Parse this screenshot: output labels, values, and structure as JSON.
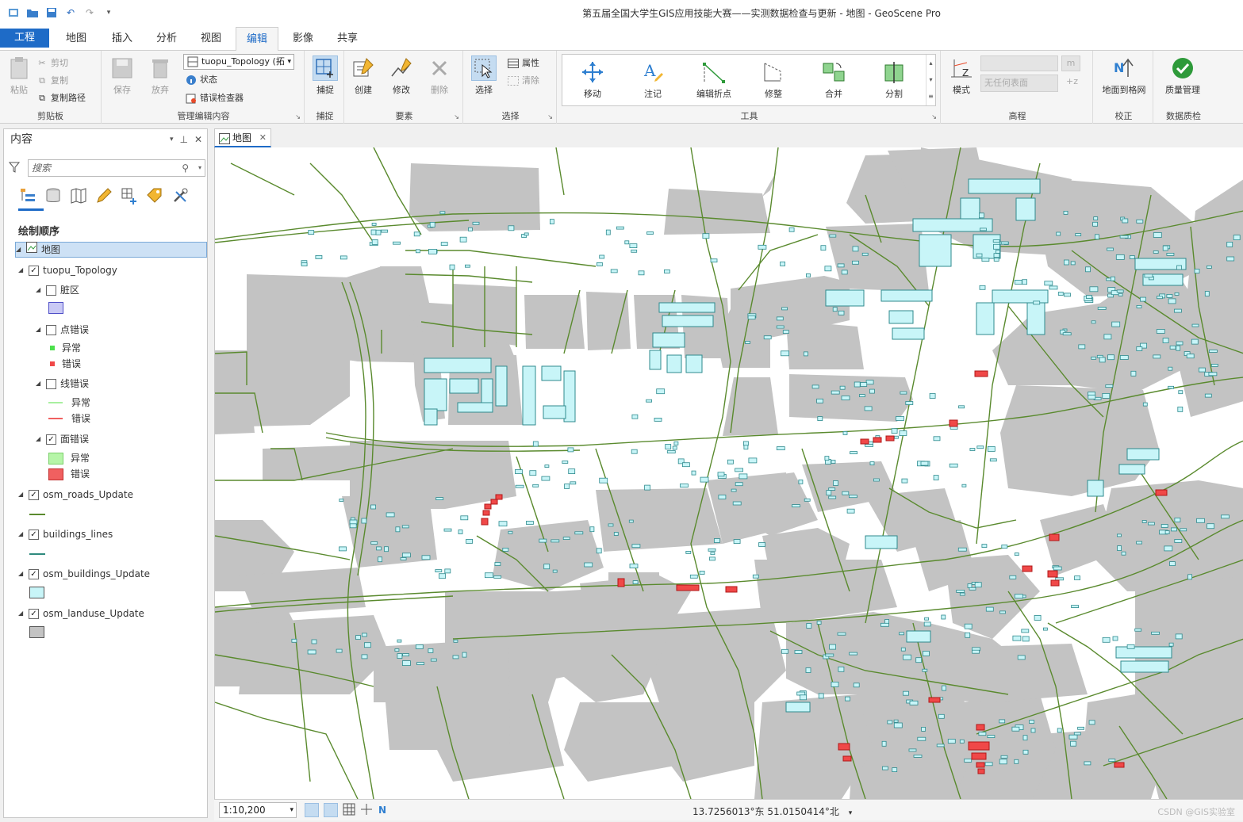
{
  "window": {
    "title": "第五届全国大学生GIS应用技能大赛——实测数据检查与更新 - 地图 - GeoScene Pro"
  },
  "tabs": [
    {
      "label": "工程"
    },
    {
      "label": "地图"
    },
    {
      "label": "插入"
    },
    {
      "label": "分析"
    },
    {
      "label": "视图"
    },
    {
      "label": "编辑"
    },
    {
      "label": "影像"
    },
    {
      "label": "共享"
    }
  ],
  "ribbon": {
    "clipboard": {
      "paste": "粘贴",
      "cut": "剪切",
      "copy": "复制",
      "copy_path": "复制路径",
      "label": "剪贴板"
    },
    "manage": {
      "save": "保存",
      "discard": "放弃",
      "topology_select": "tuopu_Topology (拓",
      "status": "状态",
      "error_inspector": "错误检查器",
      "label": "管理编辑内容"
    },
    "snap": {
      "snap": "捕捉",
      "label": "捕捉"
    },
    "features": {
      "create": "创建",
      "modify": "修改",
      "delete": "删除",
      "label": "要素"
    },
    "selection": {
      "select": "选择",
      "attributes": "属性",
      "clear": "清除",
      "label": "选择"
    },
    "tools": {
      "move": "移动",
      "annotate": "注记",
      "edit_vertices": "编辑折点",
      "reshape": "修整",
      "merge": "合并",
      "split": "分割",
      "label": "工具"
    },
    "elevation": {
      "mode": "模式",
      "surface": "无任何表面",
      "unit": "m",
      "label": "高程"
    },
    "correction": {
      "georef": "地面到格网",
      "label": "校正"
    },
    "dq": {
      "quality": "质量管理",
      "label": "数据质检"
    }
  },
  "contents": {
    "title": "内容",
    "search_placeholder": "搜索",
    "draw_order": "绘制顺序",
    "map_name": "地图",
    "layers": {
      "topology": "tuopu_Topology",
      "dirty": "脏区",
      "point_errors": "点错误",
      "line_errors": "线错误",
      "poly_errors": "面错误",
      "exception": "异常",
      "error": "错误",
      "roads": "osm_roads_Update",
      "blines": "buildings_lines",
      "buildings": "osm_buildings_Update",
      "landuse": "osm_landuse_Update"
    }
  },
  "map_tab": "地图",
  "status": {
    "scale": "1:10,200",
    "coords": "13.7256013°东 51.0150414°北",
    "watermark": "CSDN @GIS实验室"
  },
  "colors": {
    "accent": "#1e6bc7",
    "landuse": "#c3c3c3",
    "building_fill": "#c8f5f8",
    "building_stroke": "#2f8a8e",
    "road": "#5a8a2e",
    "error": "#f04848",
    "exception": "#b6f5a8"
  },
  "icons": [
    "new-project-icon",
    "open-icon",
    "save-icon",
    "undo-icon",
    "redo-icon",
    "search-icon",
    "person-icon",
    "filter-icon",
    "layers-view-icon",
    "database-view-icon",
    "map-view-icon",
    "pencil-icon",
    "grid-add-icon",
    "tag-icon",
    "tools-icon",
    "pin-icon",
    "close-icon",
    "map-icon"
  ]
}
